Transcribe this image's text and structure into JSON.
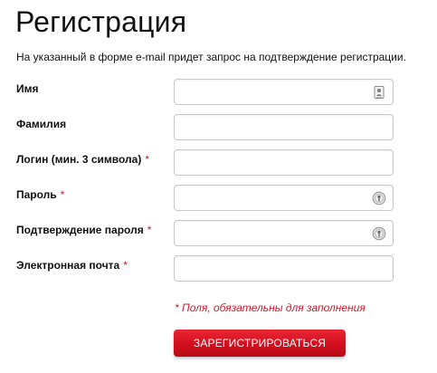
{
  "header": {
    "title": "Регистрация",
    "subtitle": "На указанный в форме e-mail придет запрос на подтверждение регистрации."
  },
  "form": {
    "fields": [
      {
        "label": "Имя",
        "required": "",
        "value": "",
        "icon": "contact-card-icon"
      },
      {
        "label": "Фамилия",
        "required": "",
        "value": "",
        "icon": ""
      },
      {
        "label": "Логин (мин. 3 символа)",
        "required": "*",
        "value": "",
        "icon": ""
      },
      {
        "label": "Пароль",
        "required": "*",
        "value": "",
        "icon": "password-manager-icon"
      },
      {
        "label": "Подтверждение пароля",
        "required": "*",
        "value": "",
        "icon": "password-manager-icon"
      },
      {
        "label": "Электронная почта",
        "required": "*",
        "value": "",
        "icon": ""
      }
    ],
    "required_note": "* Поля, обязательны для заполнения",
    "submit_label": "ЗАРЕГИСТРИРОВАТЬСЯ"
  },
  "colors": {
    "accent": "#d20f1e",
    "required_marker": "#cc1a2a"
  }
}
